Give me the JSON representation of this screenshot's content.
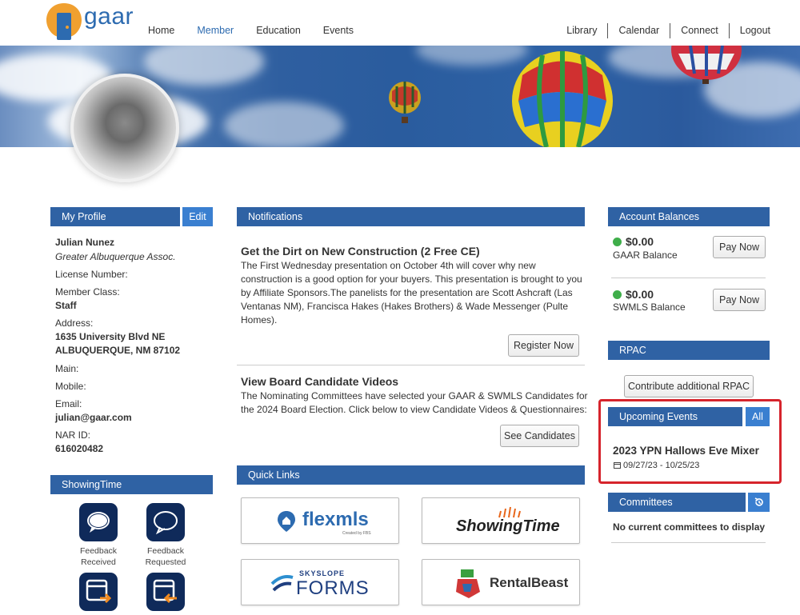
{
  "brand": {
    "name": "gaar"
  },
  "nav": {
    "left": [
      "Home",
      "Member",
      "Education",
      "Events"
    ],
    "active": "Member",
    "right": [
      "Library",
      "Calendar",
      "Connect",
      "Logout"
    ]
  },
  "profile": {
    "header": "My Profile",
    "edit_label": "Edit",
    "name": "Julian Nunez",
    "org": "Greater Albuquerque Assoc.",
    "license_label": "License Number:",
    "member_class_label": "Member Class:",
    "member_class": "Staff",
    "address_label": "Address:",
    "address_line1": "1635 University Blvd NE",
    "address_line2": "ALBUQUERQUE, NM 87102",
    "main_label": "Main:",
    "mobile_label": "Mobile:",
    "email_label": "Email:",
    "email": "julian@gaar.com",
    "nar_label": "NAR ID:",
    "nar_id": "616020482"
  },
  "showingtime": {
    "header": "ShowingTime",
    "items": [
      {
        "label_line1": "Feedback",
        "label_line2": "Received",
        "icon": "speech-bubble-icon"
      },
      {
        "label_line1": "Feedback",
        "label_line2": "Requested",
        "icon": "speech-bubble-outline-icon"
      },
      {
        "icon": "calendar-arrow-icon"
      },
      {
        "icon": "calendar-return-icon"
      }
    ]
  },
  "notifications": {
    "header": "Notifications",
    "items": [
      {
        "title": "Get the Dirt on New Construction (2 Free CE)",
        "lines": [
          "The First Wednesday presentation on October 4th will cover why new",
          "construction is a good option for your buyers. This presentation is brought to you",
          "by Affiliate Sponsors.The panelists for the presentation are Scott Ashcraft (Las",
          "Ventanas NM), Francisca Hakes (Hakes Brothers) & Wade Messenger (Pulte",
          "Homes)."
        ],
        "button": "Register Now"
      },
      {
        "title": "View Board Candidate Videos",
        "lines": [
          "The Nominating Committees have selected your GAAR & SWMLS Candidates for",
          "the 2024 Board Election. Click below to view Candidate Videos & Questionnaires:"
        ],
        "button": "See Candidates"
      }
    ]
  },
  "quick_links": {
    "header": "Quick Links",
    "tiles": [
      {
        "name": "flexmls",
        "sub": "Created by FBS"
      },
      {
        "name": "ShowingTime"
      },
      {
        "name_top": "SKYSLOPE",
        "name": "FORMS"
      },
      {
        "name": "RentalBeast"
      }
    ]
  },
  "balances": {
    "header": "Account Balances",
    "items": [
      {
        "amount": "$0.00",
        "label": "GAAR Balance",
        "button": "Pay Now",
        "status_color": "#3fae4a"
      },
      {
        "amount": "$0.00",
        "label": "SWMLS Balance",
        "button": "Pay Now",
        "status_color": "#3fae4a"
      }
    ]
  },
  "rpac": {
    "header": "RPAC",
    "button": "Contribute additional RPAC"
  },
  "events": {
    "header": "Upcoming Events",
    "all_label": "All",
    "items": [
      {
        "title": "2023 YPN Hallows Eve Mixer",
        "dates": "09/27/23 - 10/25/23"
      }
    ]
  },
  "committees": {
    "header": "Committees",
    "empty": "No current committees to display"
  },
  "colors": {
    "header_blue": "#2f62a4",
    "accent_blue": "#3a7fd0",
    "highlight_red": "#d6242c"
  }
}
